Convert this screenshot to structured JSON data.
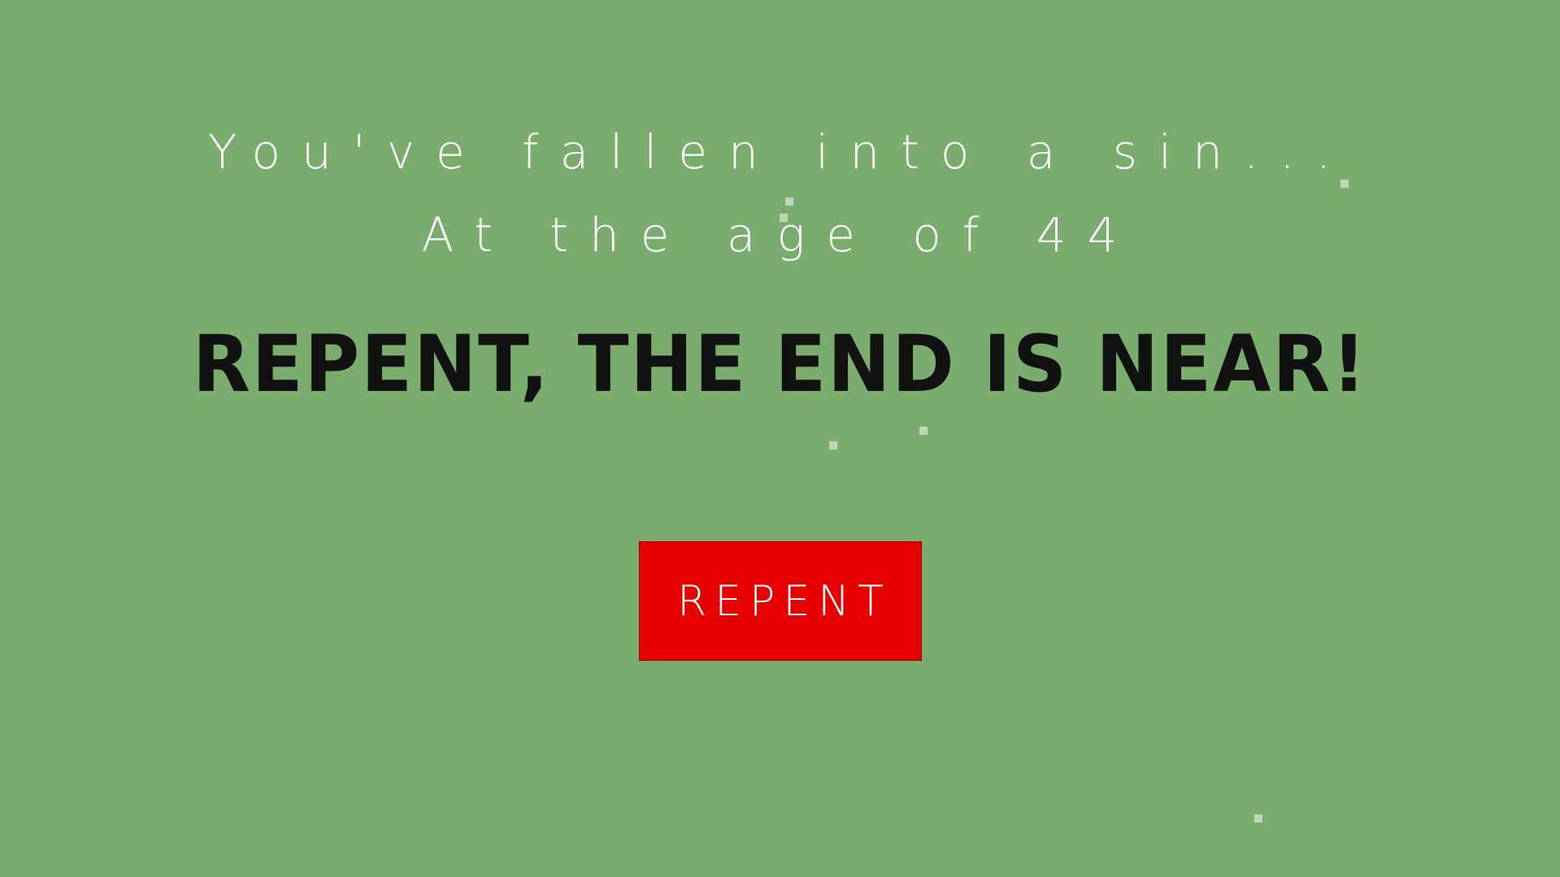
{
  "message": {
    "line1": "You've fallen into a sin...",
    "line2": "At the age of 44"
  },
  "headline": "REPENT, THE END IS NEAR!",
  "button": {
    "label": "REPENT"
  },
  "colors": {
    "background": "#79ac6d",
    "button": "#e60000",
    "headline": "#111111",
    "message": "#ffffff"
  }
}
